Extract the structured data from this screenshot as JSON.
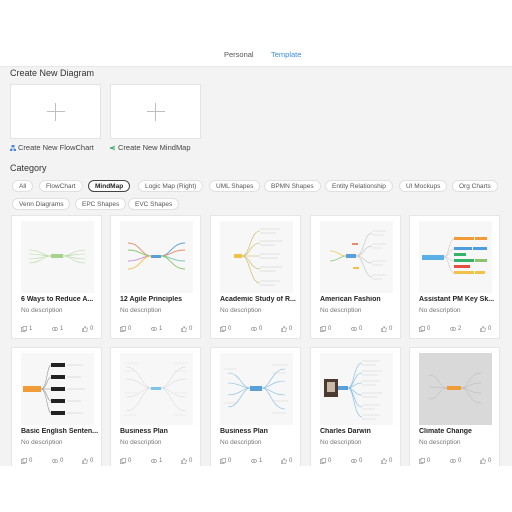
{
  "tabs": [
    {
      "label": "Personal",
      "active": false
    },
    {
      "label": "Template",
      "active": true
    }
  ],
  "create": {
    "title": "Create New Diagram",
    "flowchart_label": "Create New FlowChart",
    "mindmap_label": "Create New MindMap"
  },
  "category": {
    "title": "Category",
    "chips": [
      "All",
      "FlowChart",
      "MindMap",
      "Logic Map (Right)",
      "UML Shapes",
      "BPMN Shapes",
      "Entity Relationship",
      "UI Mockups",
      "Org Charts",
      "Venn Diagrams",
      "EPC Shapes",
      "EVC Shapes"
    ],
    "selected": "MindMap"
  },
  "templates": [
    {
      "title": "6 Ways to Reduce A...",
      "desc": "No description",
      "copies": "1",
      "views": "1",
      "likes": "0"
    },
    {
      "title": "12 Agile Principles",
      "desc": "No description",
      "copies": "0",
      "views": "1",
      "likes": "0"
    },
    {
      "title": "Academic Study of R...",
      "desc": "No description",
      "copies": "0",
      "views": "0",
      "likes": "0"
    },
    {
      "title": "American Fashion",
      "desc": "No description",
      "copies": "0",
      "views": "0",
      "likes": "0"
    },
    {
      "title": "Assistant PM Key Sk...",
      "desc": "No description",
      "copies": "0",
      "views": "2",
      "likes": "0"
    },
    {
      "title": "Basic English Senten...",
      "desc": "No description",
      "copies": "0",
      "views": "0",
      "likes": "0"
    },
    {
      "title": "Business Plan",
      "desc": "No description",
      "copies": "0",
      "views": "1",
      "likes": "0"
    },
    {
      "title": "Business Plan",
      "desc": "No description",
      "copies": "0",
      "views": "1",
      "likes": "0"
    },
    {
      "title": "Charles Darwin",
      "desc": "No description",
      "copies": "0",
      "views": "0",
      "likes": "0"
    },
    {
      "title": "Climate Change",
      "desc": "No description",
      "copies": "0",
      "views": "0",
      "likes": "0"
    }
  ],
  "colors": {
    "accent": "#3c8bd9",
    "background": "#f3f3f3",
    "card": "#ffffff"
  },
  "icons": {
    "copy": "copy-icon",
    "view": "eye-icon",
    "like": "thumbs-up-icon"
  }
}
